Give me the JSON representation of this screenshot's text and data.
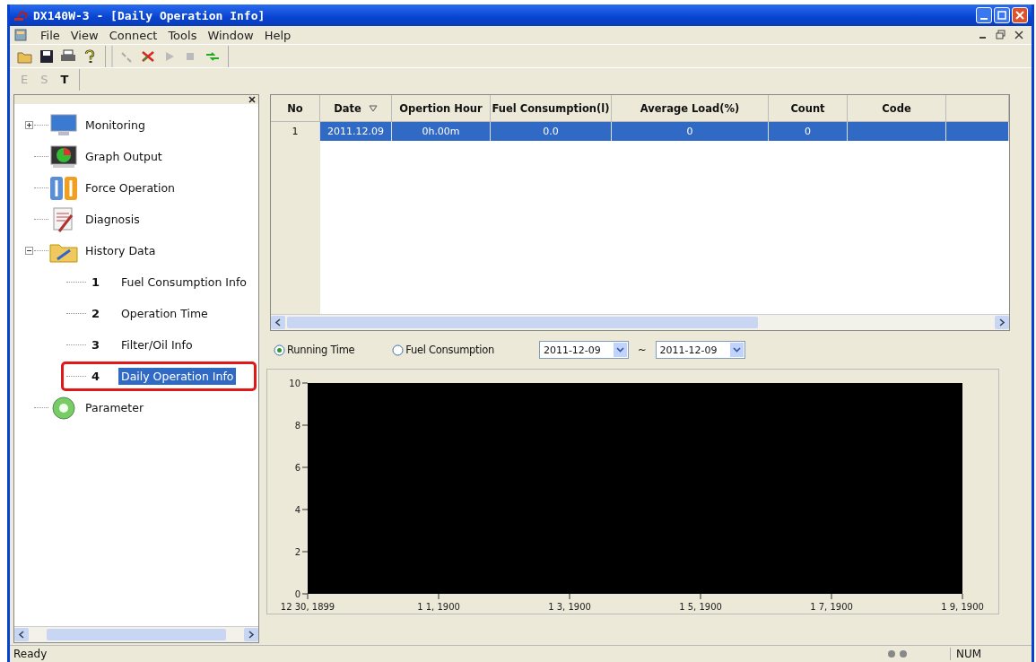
{
  "window": {
    "title": "DX140W-3 - [Daily Operation Info]"
  },
  "menu": [
    "File",
    "View",
    "Connect",
    "Tools",
    "Window",
    "Help"
  ],
  "mode_buttons": [
    {
      "label": "E",
      "disabled": true
    },
    {
      "label": "S",
      "disabled": true
    },
    {
      "label": "T",
      "disabled": false
    }
  ],
  "tree": [
    {
      "label": "Monitoring",
      "expanded": false,
      "selected": false
    },
    {
      "label": "Graph Output",
      "selected": false
    },
    {
      "label": "Force Operation",
      "selected": false
    },
    {
      "label": "Diagnosis",
      "selected": false
    },
    {
      "label": "History Data",
      "expanded": true,
      "selected": false,
      "children": [
        {
          "number": "1",
          "label": "Fuel Consumption Info",
          "selected": false
        },
        {
          "number": "2",
          "label": "Operation Time",
          "selected": false
        },
        {
          "number": "3",
          "label": "Filter/Oil Info",
          "selected": false
        },
        {
          "number": "4",
          "label": "Daily Operation Info",
          "selected": true
        }
      ]
    },
    {
      "label": "Parameter",
      "selected": false
    }
  ],
  "table": {
    "columns": [
      "No",
      "Date",
      "Opertion Hour",
      "Fuel Consumption(l)",
      "Average Load(%)",
      "Count",
      "Code"
    ],
    "rows": [
      {
        "cells": [
          "1",
          "2011.12.09",
          "0h.00m",
          "0.0",
          "0",
          "0",
          ""
        ],
        "selected": true
      }
    ]
  },
  "chart_options": [
    {
      "label": "Running Time",
      "selected": true
    },
    {
      "label": "Fuel Consumption",
      "selected": false
    }
  ],
  "date_range": {
    "from": "2011-12-09",
    "separator": "~",
    "to": "2011-12-09"
  },
  "chart_data": {
    "type": "line",
    "ylim": [
      0,
      10
    ],
    "yticks": [
      0,
      2,
      4,
      6,
      8,
      10
    ],
    "categories": [
      "12 30, 1899",
      "1 1, 1900",
      "1 3, 1900",
      "1 5, 1900",
      "1 7, 1900",
      "1 9, 1900"
    ]
  },
  "status_bar": {
    "message": "Ready",
    "indicator": "NUM"
  }
}
